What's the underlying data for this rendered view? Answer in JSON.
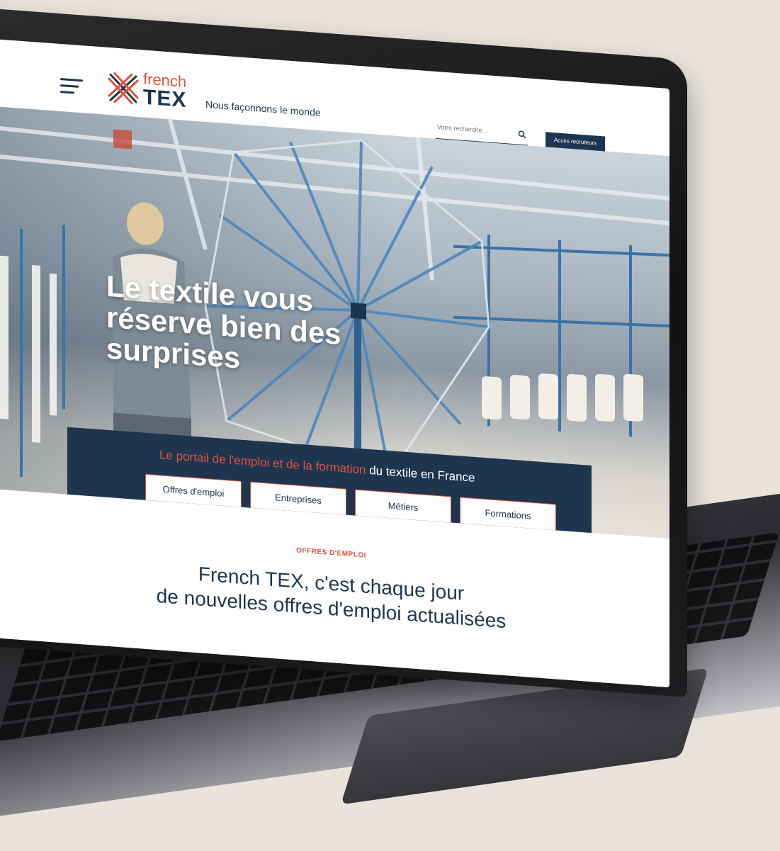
{
  "header": {
    "logo_french": "french",
    "logo_tex": "TEX",
    "tagline": "Nous façonnons le monde",
    "search_placeholder": "Votre recherche...",
    "recruiter_button": "Accès recruteurs"
  },
  "hero": {
    "title_line1": "Le textile vous",
    "title_line2": "réserve bien des",
    "title_line3": "surprises"
  },
  "portal": {
    "text_accent": "Le portail de l'emploi et de la formation",
    "text_rest": " du textile en France",
    "buttons": [
      "Offres d'emploi",
      "Entreprises",
      "Métiers",
      "Formations"
    ]
  },
  "section": {
    "label": "OFFRES D'EMPLOI",
    "heading_line1": "French TEX, c'est chaque jour",
    "heading_line2": "de nouvelles offres d'emploi actualisées"
  },
  "colors": {
    "navy": "#1e3550",
    "accent": "#e0513b",
    "background": "#e9e3d9"
  },
  "icons": [
    "menu-icon",
    "search-icon",
    "logo-mark-icon"
  ]
}
